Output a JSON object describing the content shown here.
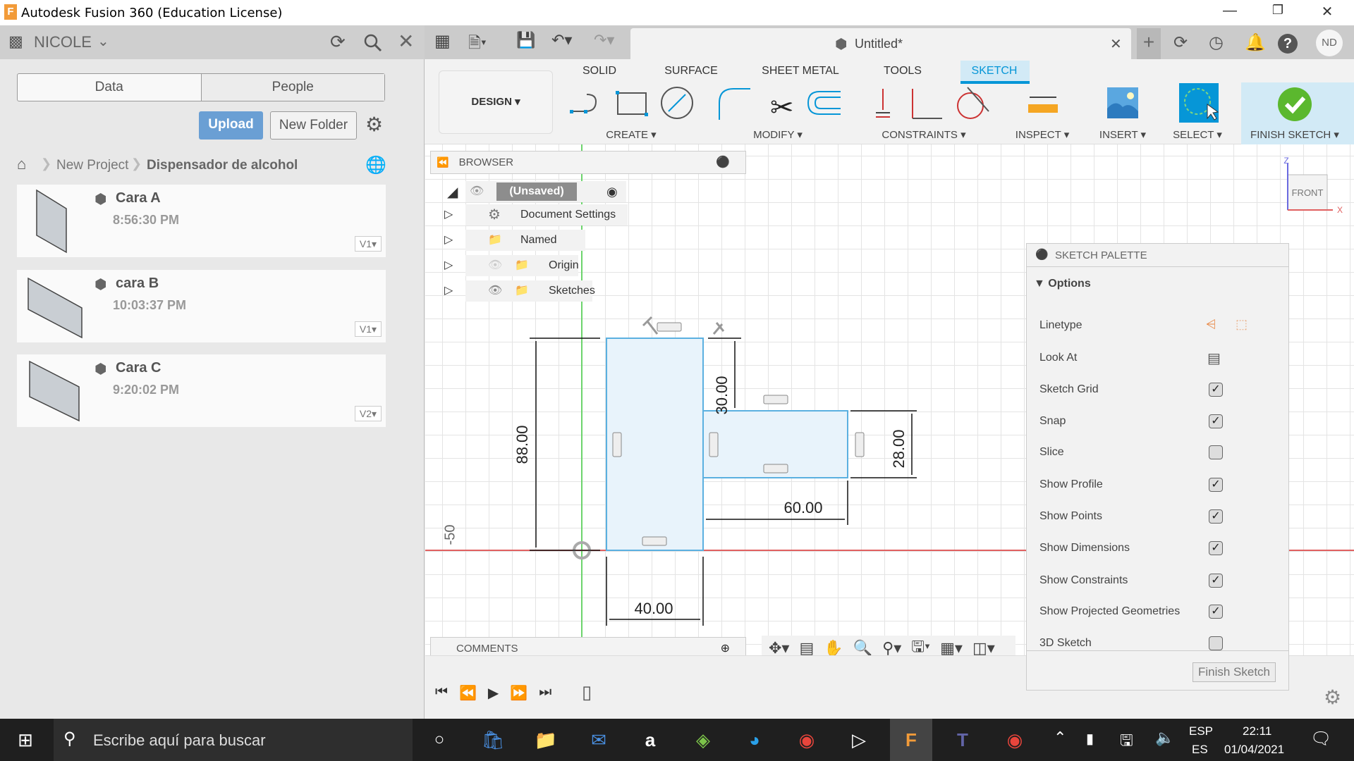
{
  "window": {
    "title": "Autodesk Fusion 360 (Education License)"
  },
  "left_panel": {
    "user": "NICOLE",
    "tabs": [
      "Data",
      "People"
    ],
    "upload_label": "Upload",
    "new_folder_label": "New Folder",
    "breadcrumb": [
      "New Project",
      "Dispensador de alcohol"
    ],
    "files": [
      {
        "name": "Cara A",
        "time": "8:56:30 PM",
        "version": "V1"
      },
      {
        "name": "cara B",
        "time": "10:03:37 PM",
        "version": "V1"
      },
      {
        "name": "Cara C",
        "time": "9:20:02 PM",
        "version": "V2"
      }
    ]
  },
  "toolbar": {
    "doc_title": "Untitled*",
    "user_initials": "ND",
    "tabs": [
      "SOLID",
      "SURFACE",
      "SHEET METAL",
      "TOOLS",
      "SKETCH"
    ],
    "active_tab": "SKETCH",
    "workspace": "DESIGN",
    "groups": [
      "CREATE",
      "MODIFY",
      "CONSTRAINTS",
      "INSPECT",
      "INSERT",
      "SELECT",
      "FINISH SKETCH"
    ]
  },
  "browser": {
    "title": "BROWSER",
    "root": "(Unsaved)",
    "items": [
      "Document Settings",
      "Named Views",
      "Origin",
      "Sketches"
    ]
  },
  "sketch": {
    "dimensions": [
      "88.00",
      "30.00",
      "28.00",
      "60.00",
      "40.00"
    ],
    "axis_label": "-50"
  },
  "viewcube": {
    "face": "FRONT",
    "axis_z": "Z",
    "axis_x": "X"
  },
  "palette": {
    "title": "SKETCH PALETTE",
    "section": "Options",
    "rows": [
      {
        "label": "Linetype",
        "type": "icons"
      },
      {
        "label": "Look At",
        "type": "icon"
      },
      {
        "label": "Sketch Grid",
        "type": "checkbox",
        "checked": true
      },
      {
        "label": "Snap",
        "type": "checkbox",
        "checked": true
      },
      {
        "label": "Slice",
        "type": "checkbox",
        "checked": false
      },
      {
        "label": "Show Profile",
        "type": "checkbox",
        "checked": true
      },
      {
        "label": "Show Points",
        "type": "checkbox",
        "checked": true
      },
      {
        "label": "Show Dimensions",
        "type": "checkbox",
        "checked": true
      },
      {
        "label": "Show Constraints",
        "type": "checkbox",
        "checked": true
      },
      {
        "label": "Show Projected Geometries",
        "type": "checkbox",
        "checked": true
      },
      {
        "label": "3D Sketch",
        "type": "checkbox",
        "checked": false
      }
    ],
    "finish_label": "Finish Sketch"
  },
  "comments": {
    "title": "COMMENTS"
  },
  "taskbar": {
    "search_placeholder": "Escribe aquí para buscar",
    "lang_top": "ESP",
    "lang_bottom": "ES",
    "time": "22:11",
    "date": "01/04/2021"
  },
  "colors": {
    "accent": "#0696d7",
    "upload": "#6a9fd4",
    "finish": "#5bb82e",
    "x_axis": "#e06060",
    "y_axis": "#6cd46c",
    "profile": "#e8f3fb"
  }
}
